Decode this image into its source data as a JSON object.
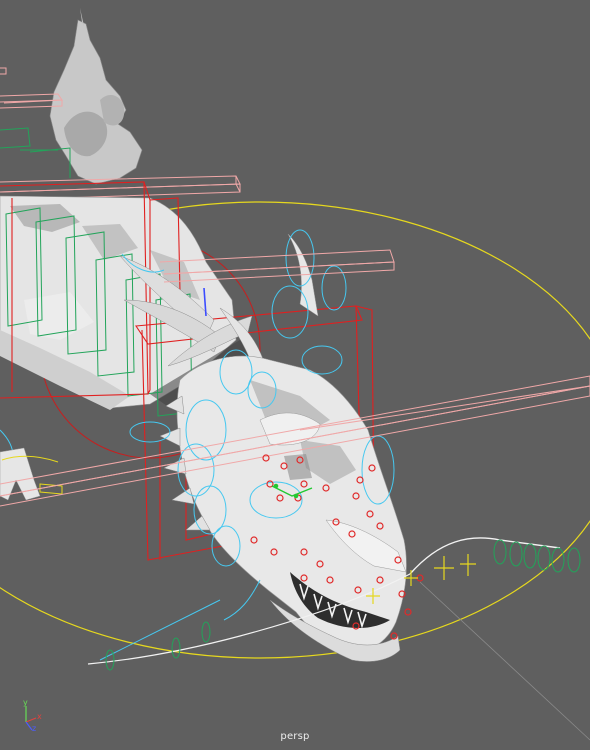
{
  "viewport": {
    "camera_label": "persp",
    "background": "#5f5f5f"
  },
  "axis_gizmo": {
    "x_label": "x",
    "y_label": "y",
    "z_label": "z",
    "x_color": "#e0433f",
    "y_color": "#66dd55",
    "z_color": "#4d5cff"
  },
  "scene": {
    "subject": "dragon-model",
    "colors": {
      "mesh": "#e9e9e9",
      "mesh_shadow": "#9c9c9c",
      "ik_box": "#f0a8a8",
      "fk_box": "#e02020",
      "spine_ctrl": "#22a45a",
      "face_ctrl": "#46c8f0",
      "face_joint": "#e02a2a",
      "ground_ctrl": "#e6d81e",
      "curve": "#f2f2f2"
    }
  }
}
